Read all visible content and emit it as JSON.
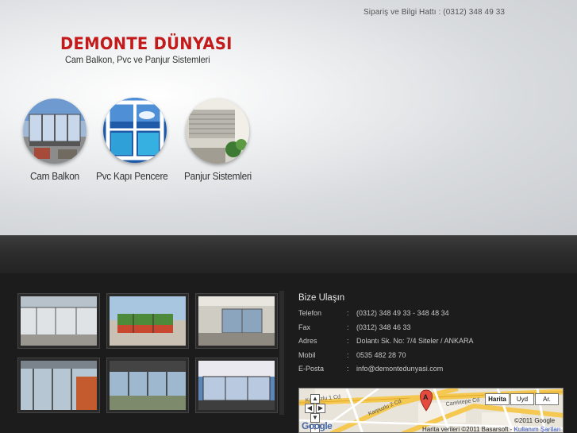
{
  "header": {
    "hotline": "Sipariş ve Bilgi Hattı : (0312) 348 49 33",
    "logo_title": "DEMONTE DÜNYASI",
    "logo_subtitle": "Cam Balkon, Pvc  ve Panjur Sistemleri"
  },
  "categories": [
    {
      "label": "Cam Balkon",
      "icon": "glass-balcony-photo"
    },
    {
      "label": "Pvc Kapı Pencere",
      "icon": "pvc-window-photo"
    },
    {
      "label": "Panjur Sistemleri",
      "icon": "shutter-photo"
    }
  ],
  "contact": {
    "title": "Bize Ulaşın",
    "rows": [
      {
        "key": "Telefon",
        "sep": ":",
        "value": "(0312) 348 49 33 - 348 48 34"
      },
      {
        "key": "Fax",
        "sep": ":",
        "value": "(0312) 348 46 33"
      },
      {
        "key": "Adres",
        "sep": ":",
        "value": "Dolantı Sk. No: 7/4 Siteler / ANKARA"
      },
      {
        "key": "Mobil",
        "sep": ":",
        "value": "0535 482 28 70"
      },
      {
        "key": "E-Posta",
        "sep": ":",
        "value": "info@demontedunyasi.com"
      }
    ]
  },
  "map": {
    "type_buttons": [
      "Harita",
      "Uyd",
      "Ar."
    ],
    "marker": "A",
    "logo": "Google",
    "copyright1": "©2011 Google",
    "copyright2_prefix": "Harita verileri ©2011 Basarsoft - ",
    "terms": "Kullanım Şartları",
    "streets": [
      "Karpuzlu 1 Cd",
      "Karpuzlu 2 Cd",
      "Camlıtepe Cd"
    ]
  },
  "colors": {
    "brand_red": "#c31b1b",
    "dark_bg": "#1c1c1c"
  }
}
